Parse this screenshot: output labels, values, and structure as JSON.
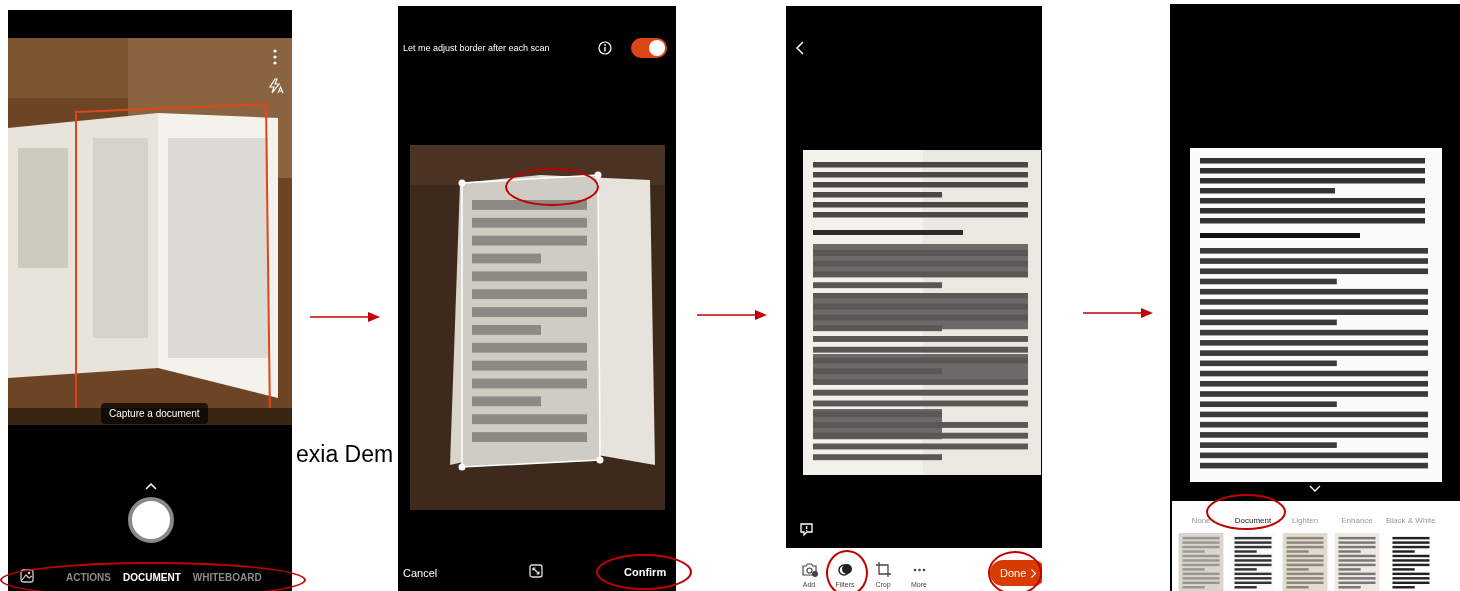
{
  "background_text": "exia Dem",
  "capture_screen": {
    "hint": "Capture a document",
    "modes": [
      {
        "label": "ACTIONS",
        "selected": false
      },
      {
        "label": "DOCUMENT",
        "selected": true
      },
      {
        "label": "WHITEBOARD",
        "selected": false
      }
    ]
  },
  "border_screen": {
    "setting": "Let me adjust border after each scan",
    "toggle_on": true,
    "cancel": "Cancel",
    "confirm": "Confirm"
  },
  "edit_screen": {
    "tools": [
      {
        "kind": "add",
        "label": "Add"
      },
      {
        "kind": "filters",
        "label": "Filters"
      },
      {
        "kind": "crop",
        "label": "Crop"
      },
      {
        "kind": "more",
        "label": "More"
      }
    ],
    "done": "Done"
  },
  "filter_screen": {
    "filters": [
      {
        "label": "None",
        "selected": false
      },
      {
        "label": "Document",
        "selected": true
      },
      {
        "label": "Lighten",
        "selected": false
      },
      {
        "label": "Enhance",
        "selected": false
      },
      {
        "label": "Black & White",
        "selected": false
      }
    ]
  }
}
